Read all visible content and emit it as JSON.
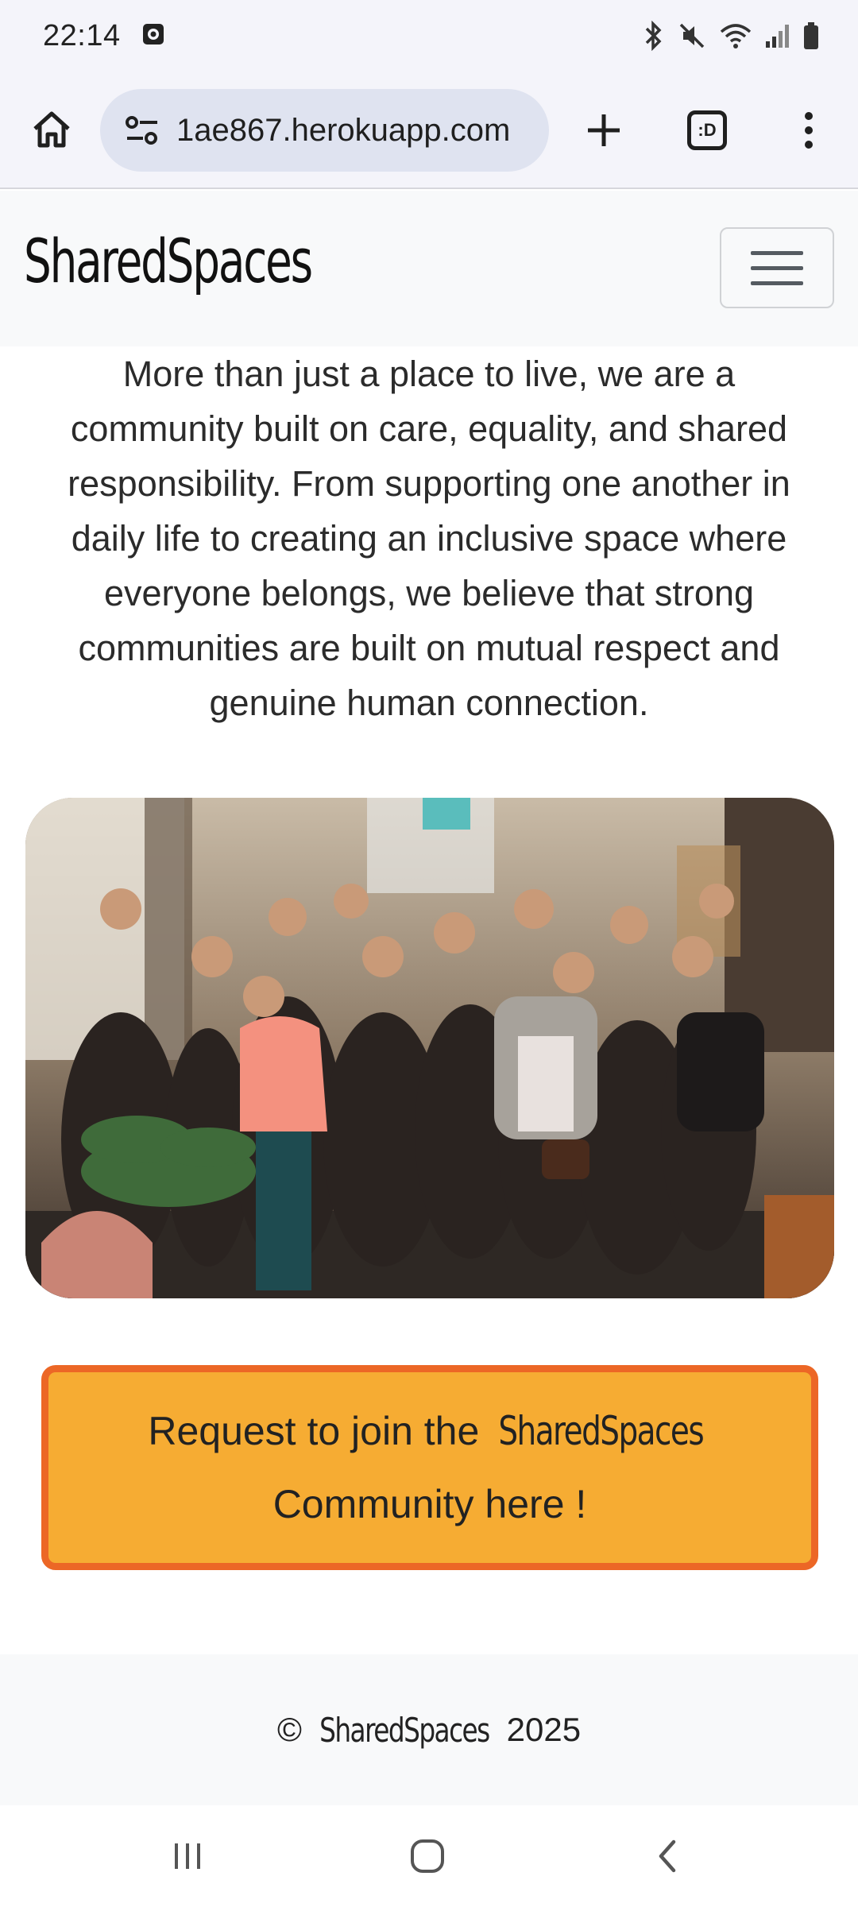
{
  "status_bar": {
    "time": "22:14",
    "icons": [
      "gallery-notification-icon",
      "bluetooth-icon",
      "mute-icon",
      "wifi-icon",
      "signal-icon",
      "battery-icon"
    ]
  },
  "browser": {
    "url": "1ae867.herokuapp.com",
    "tab_count_label": ":D",
    "icons": [
      "home-icon",
      "site-settings-icon",
      "new-tab-icon",
      "tabs-icon",
      "more-vert-icon"
    ]
  },
  "site": {
    "brand": "SharedSpaces",
    "intro": "More than just a place to live, we are a community built on care, equality, and shared responsibility. From supporting one another in daily life to creating an inclusive space where everyone belongs, we believe that strong communities are built on mutual respect and genuine human connection.",
    "join_button": {
      "prefix": "Request to join the",
      "brand": "SharedSpaces",
      "suffix": "Community here !"
    },
    "footer": {
      "copyright_symbol": "©",
      "brand": "SharedSpaces",
      "year": "2025"
    }
  },
  "colors": {
    "button_fill": "#f6ac33",
    "button_border": "#ec6726",
    "navbar_bg": "#f8f9fa",
    "chrome_bg": "#f4f4fa",
    "url_pill_bg": "#dfe3f0"
  },
  "android_nav": {
    "icons": [
      "recents-icon",
      "home-circle-icon",
      "back-icon"
    ]
  }
}
